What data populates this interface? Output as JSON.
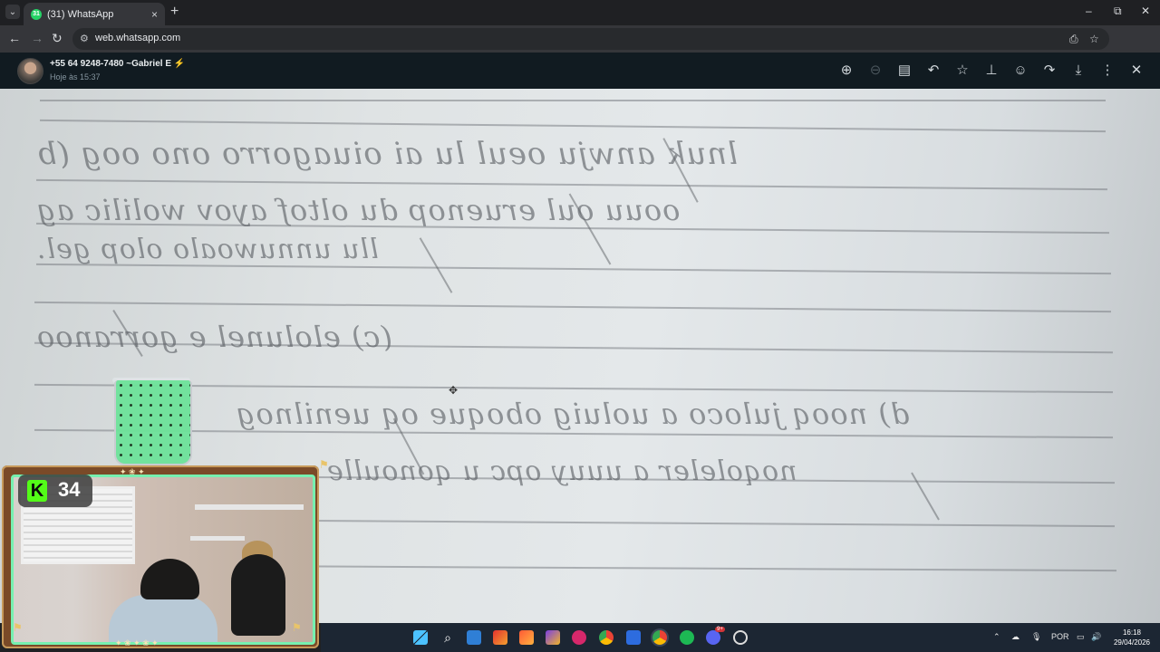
{
  "browser": {
    "tab": {
      "title": "(31) WhatsApp",
      "favicon_badge": "31",
      "close_icon": "×"
    },
    "new_tab_icon": "+",
    "window_controls": [
      "–",
      "⧉",
      "✕"
    ],
    "url": "web.whatsapp.com",
    "nav_icons": [
      "←",
      "→",
      "↻"
    ]
  },
  "viewer": {
    "contact_name": "+55 64 9248-7480 ~Gabriel E ⚡",
    "timestamp": "Hoje às 15:37",
    "actions": [
      {
        "name": "zoom-in-icon",
        "glyph": "⊕"
      },
      {
        "name": "zoom-out-icon",
        "glyph": "⊖",
        "disabled": true
      },
      {
        "name": "message-icon",
        "glyph": "▤"
      },
      {
        "name": "reply-icon",
        "glyph": "↶"
      },
      {
        "name": "star-icon",
        "glyph": "☆"
      },
      {
        "name": "pin-icon",
        "glyph": "⊥"
      },
      {
        "name": "emoji-icon",
        "glyph": "☺"
      },
      {
        "name": "forward-icon",
        "glyph": "↷"
      },
      {
        "name": "download-icon",
        "glyph": "⤓"
      },
      {
        "name": "more-icon",
        "glyph": "⋮"
      },
      {
        "name": "close-icon",
        "glyph": "✕"
      }
    ]
  },
  "overlay": {
    "kick_badge_letter": "K",
    "kick_count": "34"
  },
  "taskbar": {
    "language": "POR",
    "time": "16:18",
    "date": "29/04/2026",
    "notification_badge": "9+"
  }
}
